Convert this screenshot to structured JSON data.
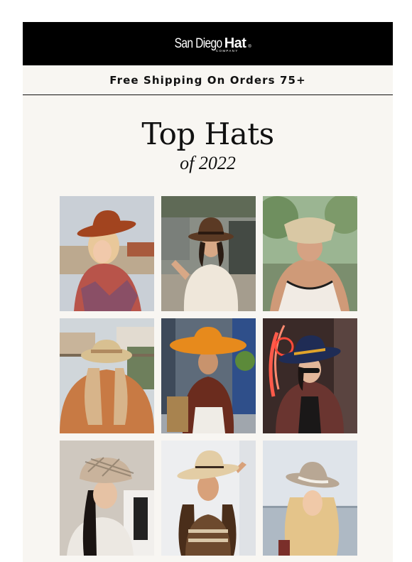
{
  "header": {
    "brand_name": "San Diego",
    "brand_hat": "Hat",
    "brand_reg": "®",
    "brand_company": "COMPANY"
  },
  "promo": {
    "text": "Free Shipping On Orders 75+"
  },
  "hero": {
    "title": "Top Hats",
    "subtitle": "of 2022"
  },
  "products": [
    {
      "icon": "rust-wide-brim-hat-photo",
      "hat_color": "#a2441f"
    },
    {
      "icon": "brown-fedora-photo",
      "hat_color": "#5b3a24"
    },
    {
      "icon": "straw-visor-photo",
      "hat_color": "#d9c8a4"
    },
    {
      "icon": "straw-boater-photo",
      "hat_color": "#d8c091"
    },
    {
      "icon": "orange-sun-hat-photo",
      "hat_color": "#e78a1c"
    },
    {
      "icon": "navy-fedora-photo",
      "hat_color": "#1f2c55"
    },
    {
      "icon": "plaid-bucket-hat-photo",
      "hat_color": "#c9b39c"
    },
    {
      "icon": "straw-cowboy-hat-photo",
      "hat_color": "#e3cda5"
    },
    {
      "icon": "taupe-boater-photo",
      "hat_color": "#b8a794"
    }
  ]
}
